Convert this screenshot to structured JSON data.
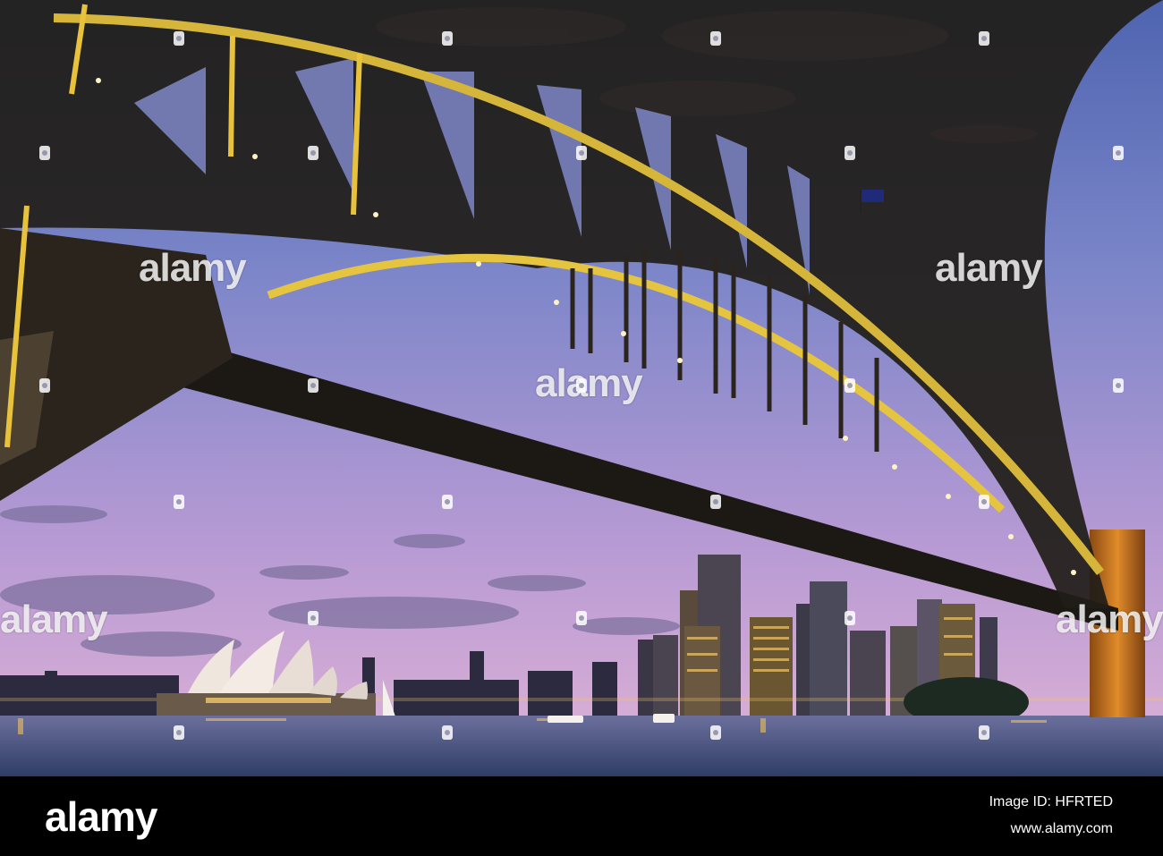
{
  "watermark": {
    "text": "alamy"
  },
  "footer": {
    "logo": "alamy",
    "image_id": "Image ID: HFRTED",
    "url": "www.alamy.com"
  },
  "colors": {
    "sky_top": "#5b6fb8",
    "sky_bottom": "#d8a9d6",
    "water": "#4a5d8a",
    "bridge_steel": "#1d1a16",
    "bridge_glow": "#e7c23a"
  }
}
